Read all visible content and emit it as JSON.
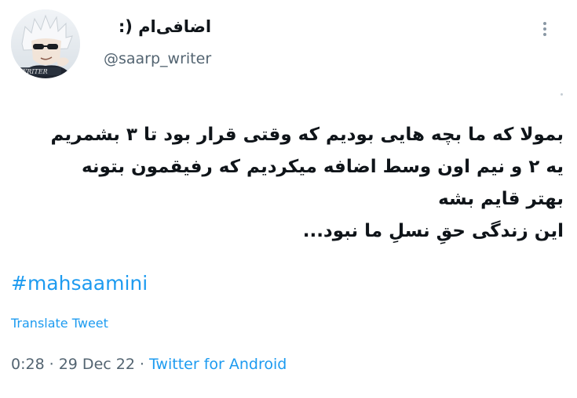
{
  "author": {
    "display_name": "اضافی‌ام (:",
    "handle": "@saarp_writer",
    "avatar_badge": "WRITER"
  },
  "menu": {
    "icon": "more-vertical-icon"
  },
  "tweet": {
    "lines": [
      "بمولا که ما بچه هایی بودیم که وقتی قرار بود تا ۳ بشمریم",
      "یه ۲ و نیم اون وسط اضافه میکردیم که رفیقمون بتونه",
      "بهتر قایم بشه",
      "این زندگی حقِ نسلِ ما نبود..."
    ],
    "hashtag": "#mahsaamini",
    "translate_label": "Translate Tweet"
  },
  "meta": {
    "time": "0:28",
    "separator": "·",
    "date": "29 Dec 22",
    "source": "Twitter for Android"
  },
  "colors": {
    "link": "#1d9bf0",
    "secondary_text": "#536471",
    "primary_text": "#0f1419"
  }
}
